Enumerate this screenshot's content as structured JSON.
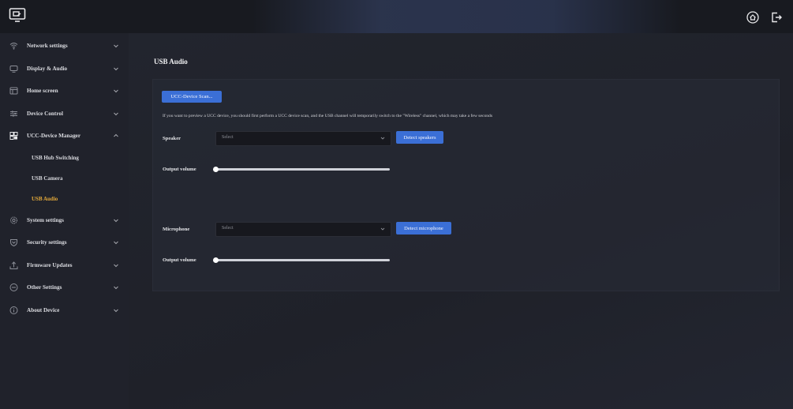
{
  "header": {
    "logo_icon": "screen-share-icon",
    "home_icon": "home-icon",
    "logout_icon": "logout-icon"
  },
  "sidebar": {
    "items": [
      {
        "label": "Network settings",
        "icon": "wifi-icon",
        "expanded": false
      },
      {
        "label": "Display & Audio",
        "icon": "monitor-icon",
        "expanded": false
      },
      {
        "label": "Home screen",
        "icon": "home-screen-icon",
        "expanded": false
      },
      {
        "label": "Device Control",
        "icon": "sliders-icon",
        "expanded": false
      },
      {
        "label": "UCC-Device Manager",
        "icon": "device-manager-icon",
        "expanded": true,
        "children": [
          {
            "label": "USB Hub Switching",
            "active": false
          },
          {
            "label": "USB Camera",
            "active": false
          },
          {
            "label": "USB Audio",
            "active": true
          }
        ]
      },
      {
        "label": "System settings",
        "icon": "gear-icon",
        "expanded": false
      },
      {
        "label": "Security settings",
        "icon": "shield-icon",
        "expanded": false
      },
      {
        "label": "Firmware Updates",
        "icon": "upload-icon",
        "expanded": false
      },
      {
        "label": "Other Settings",
        "icon": "minus-circle-icon",
        "expanded": false
      },
      {
        "label": "About Device",
        "icon": "info-circle-icon",
        "expanded": false
      }
    ]
  },
  "main": {
    "title": "USB Audio",
    "scan_button": "UCC-Device Scan...",
    "info_text": "If you want to preview a UCC device, you should first perform a UCC device scan, and the USB channel will temporarily switch to the \"Wireless\" channel, which may take a few seconds",
    "speaker": {
      "label": "Speaker",
      "select_value": "Select",
      "detect_button": "Detect speakers",
      "volume_label": "Output volume",
      "volume": 0
    },
    "microphone": {
      "label": "Microphone",
      "select_value": "Select",
      "detect_button": "Detect microphone",
      "volume_label": "Output volume",
      "volume": 0
    }
  },
  "colors": {
    "accent": "#3b6fd6",
    "active_nav": "#e3a93a",
    "background": "#1d1f27",
    "sidebar": "#20222b"
  }
}
